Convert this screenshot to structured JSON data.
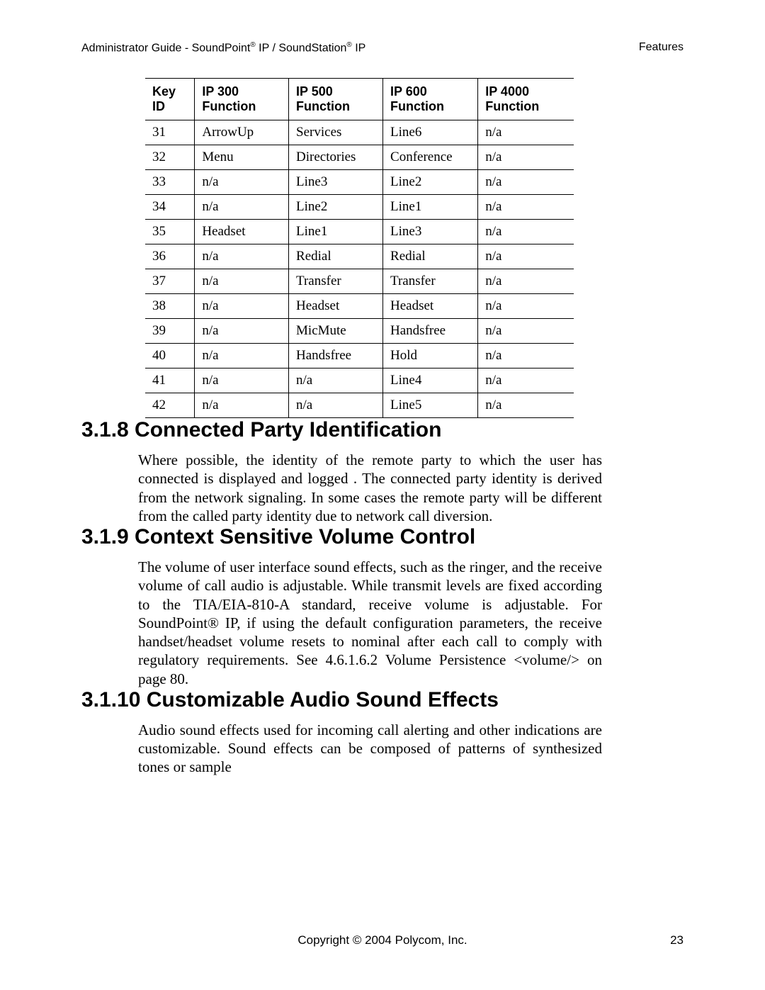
{
  "header": {
    "left_1": "Administrator Guide - SoundPoint",
    "left_sup1": "®",
    "left_2": " IP / SoundStation",
    "left_sup2": "®",
    "left_3": " IP",
    "right": "Features"
  },
  "table": {
    "headers": [
      "Key ID",
      "IP 300 Function",
      "IP 500 Function",
      "IP 600 Function",
      "IP 4000 Function"
    ],
    "rows": [
      [
        "31",
        "ArrowUp",
        "Services",
        "Line6",
        "n/a"
      ],
      [
        "32",
        "Menu",
        "Directories",
        "Conference",
        "n/a"
      ],
      [
        "33",
        "n/a",
        "Line3",
        "Line2",
        "n/a"
      ],
      [
        "34",
        "n/a",
        "Line2",
        "Line1",
        "n/a"
      ],
      [
        "35",
        "Headset",
        "Line1",
        "Line3",
        "n/a"
      ],
      [
        "36",
        "n/a",
        "Redial",
        "Redial",
        "n/a"
      ],
      [
        "37",
        "n/a",
        "Transfer",
        "Transfer",
        "n/a"
      ],
      [
        "38",
        "n/a",
        "Headset",
        "Headset",
        "n/a"
      ],
      [
        "39",
        "n/a",
        "MicMute",
        "Handsfree",
        "n/a"
      ],
      [
        "40",
        "n/a",
        "Handsfree",
        "Hold",
        "n/a"
      ],
      [
        "41",
        "n/a",
        "n/a",
        "Line4",
        "n/a"
      ],
      [
        "42",
        "n/a",
        "n/a",
        "Line5",
        "n/a"
      ]
    ]
  },
  "sections": {
    "s318": {
      "heading": "3.1.8  Connected Party Identification",
      "body": "Where possible, the identity of the remote party to which the user has connected is displayed and logged .  The connected party identity is derived from the network signaling.  In some cases the remote party will be different from the called party identity due to network call diversion."
    },
    "s319": {
      "heading": "3.1.9  Context Sensitive Volume Control",
      "body": "The volume of user interface sound effects, such as the ringer, and the receive volume of call audio is adjustable.  While transmit levels are fixed according to the TIA/EIA-810-A standard, receive volume is adjustable.  For SoundPoint® IP, if using the default configuration parameters, the receive handset/headset volume resets to nominal after each call to comply with regulatory requirements. See 4.6.1.6.2 Volume Persistence <volume/> on page 80."
    },
    "s3110": {
      "heading": "3.1.10  Customizable Audio Sound Effects",
      "body": "Audio sound effects used for incoming call alerting and other indications are customizable.  Sound effects can be composed of patterns of synthesized tones or sample"
    }
  },
  "footer": {
    "copyright": "Copyright © 2004 Polycom, Inc.",
    "page": "23"
  }
}
